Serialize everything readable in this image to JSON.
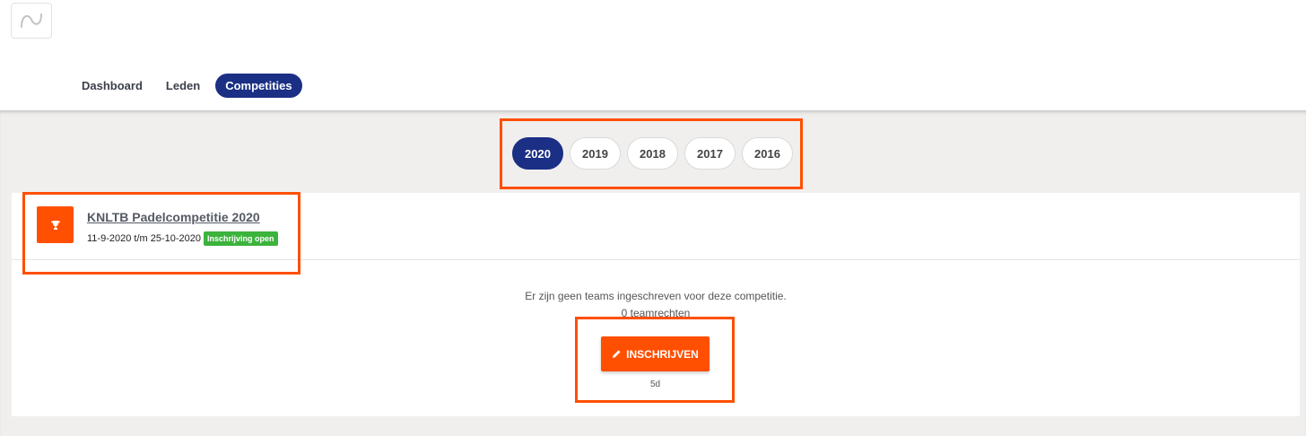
{
  "app": {
    "logo_icon": "wave-logo-icon"
  },
  "nav": {
    "items": [
      {
        "label": "Dashboard",
        "active": false
      },
      {
        "label": "Leden",
        "active": false
      },
      {
        "label": "Competities",
        "active": true
      }
    ]
  },
  "years": {
    "items": [
      "2020",
      "2019",
      "2018",
      "2017",
      "2016"
    ],
    "selected": "2020"
  },
  "competition": {
    "icon": "trophy-icon",
    "title": "KNLTB Padelcompetitie 2020",
    "dates": "11-9-2020 t/m 25-10-2020",
    "badge": "Inschrijving open",
    "empty_message": "Er zijn geen teams ingeschreven voor deze competitie.",
    "team_rights": "0 teamrechten",
    "register_label": "INSCHRIJVEN",
    "register_icon": "pencil-icon",
    "deadline": "5d"
  },
  "colors": {
    "accent": "#ff4f00",
    "primary": "#1b2f85",
    "badge_green": "#3cb33c",
    "background": "#f0efed"
  }
}
